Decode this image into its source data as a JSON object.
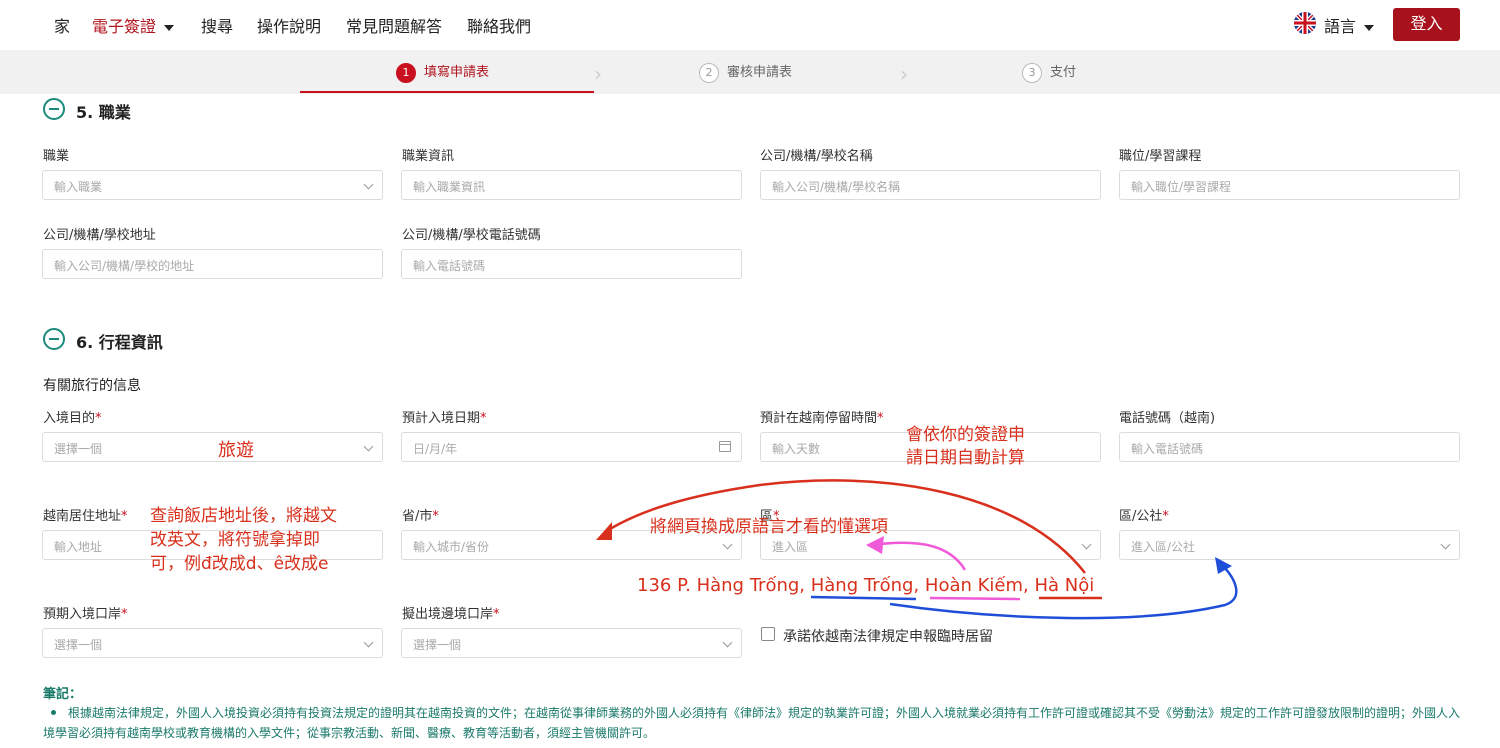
{
  "nav": {
    "home": "家",
    "evisa": "電子簽證",
    "search": "搜尋",
    "guide": "操作說明",
    "faq": "常見問題解答",
    "contact": "聯絡我們",
    "language": "語言",
    "login": "登入"
  },
  "steps": [
    {
      "num": "1",
      "label": "填寫申請表"
    },
    {
      "num": "2",
      "label": "審核申請表"
    },
    {
      "num": "3",
      "label": "支付"
    }
  ],
  "section5": {
    "title": "5. 職業",
    "fields": [
      {
        "label": "職業",
        "placeholder": "輸入職業"
      },
      {
        "label": "職業資訊",
        "placeholder": "輸入職業資訊"
      },
      {
        "label": "公司/機構/學校名稱",
        "placeholder": "輸入公司/機構/學校名稱"
      },
      {
        "label": "職位/學習課程",
        "placeholder": "輸入職位/學習課程"
      },
      {
        "label": "公司/機構/學校地址",
        "placeholder": "輸入公司/機構/學校的地址"
      },
      {
        "label": "公司/機構/學校電話號碼",
        "placeholder": "輸入電話號碼"
      }
    ]
  },
  "section6": {
    "title": "6. 行程資訊",
    "subtitle": "有關旅行的信息",
    "fields": [
      {
        "label": "入境目的",
        "placeholder": "選擇一個"
      },
      {
        "label": "預計入境日期",
        "placeholder": "日/月/年"
      },
      {
        "label": "預計在越南停留時間",
        "placeholder": "輸入天數"
      },
      {
        "label": "電話號碼（越南)",
        "placeholder": "輸入電話號碼"
      },
      {
        "label": "越南居住地址",
        "placeholder": "輸入地址"
      },
      {
        "label": "省/市",
        "placeholder": "輸入城市/省份"
      },
      {
        "label": "區",
        "placeholder": "進入區"
      },
      {
        "label": "區/公社",
        "placeholder": "進入區/公社"
      },
      {
        "label": "預期入境口岸",
        "placeholder": "選擇一個"
      },
      {
        "label": "擬出境邊境口岸",
        "placeholder": "選擇一個"
      }
    ],
    "checkbox_label": "承諾依越南法律規定申報臨時居留"
  },
  "notes": {
    "title": "筆記：",
    "text": "根據越南法律規定，外國人入境投資必須持有投資法規定的證明其在越南投資的文件；在越南從事律師業務的外國人必須持有《律師法》規定的執業許可證；外國人入境就業必須持有工作許可證或確認其不受《勞動法》規定的工作許可證發放限制的證明；外國人入境學習必須持有越南學校或教育機構的入學文件；從事宗教活動、新聞、醫療、教育等活動者，須經主管機關許可。"
  },
  "annotations": {
    "purpose": "旅遊",
    "auto_calc_1": "會依你的簽證申",
    "auto_calc_2": "請日期自動計算",
    "address_1": "查詢飯店地址後，將越文",
    "address_2": "改英文，將符號拿掉即",
    "address_3": "可，例đ改成d、ê改成e",
    "switch_lang": "將網頁換成原語言才看的懂選項",
    "example_street": "136 P. Hàng Trống, ",
    "example_ward": "Hàng Trống",
    "example_district": "Hoàn Kiếm",
    "example_city": "Hà Nội",
    "sep": ", ",
    "colors": {
      "red": "#d8301c",
      "blue": "#1f4fd8",
      "pink": "#f05ad8"
    }
  }
}
